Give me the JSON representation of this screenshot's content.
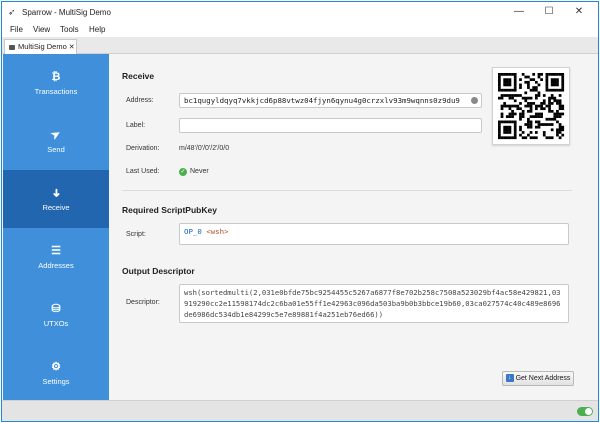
{
  "window": {
    "title": "Sparrow - MultiSig Demo",
    "controls": {
      "minimize": "—",
      "maximize": "☐",
      "close": "✕"
    }
  },
  "menu": [
    "File",
    "View",
    "Tools",
    "Help"
  ],
  "tab": {
    "label": "MultiSig Demo",
    "close": "✕"
  },
  "sidebar": {
    "items": [
      {
        "label": "Transactions",
        "icon": "bitcoin-icon",
        "glyph": "₿"
      },
      {
        "label": "Send",
        "icon": "send-icon",
        "glyph": "➤"
      },
      {
        "label": "Receive",
        "icon": "receive-icon",
        "glyph": "➜",
        "active": true
      },
      {
        "label": "Addresses",
        "icon": "addresses-icon",
        "glyph": "☰"
      },
      {
        "label": "UTXOs",
        "icon": "utxos-icon",
        "glyph": "⛁"
      },
      {
        "label": "Settings",
        "icon": "settings-icon",
        "glyph": "⚙"
      }
    ]
  },
  "receive": {
    "title": "Receive",
    "address_label": "Address:",
    "address": "bc1qugyldqyq7vkkjcd6p88vtwz04fjyn6qynu4g0crzxlv93m9wqnns0z9du9",
    "label_label": "Label:",
    "label_value": "",
    "derivation_label": "Derivation:",
    "derivation": "m/48'/0'/0'/2'/0/0",
    "last_used_label": "Last Used:",
    "last_used": "Never"
  },
  "script_section": {
    "title": "Required ScriptPubKey",
    "label": "Script:",
    "opcode": "OP_0",
    "placeholder": "<wsh>"
  },
  "descriptor_section": {
    "title": "Output Descriptor",
    "label": "Descriptor:",
    "value": "wsh(sortedmulti(2,031e0bfde75bc9254455c5267a6877f8e702b258c7508a523029bf4ac58e429821,03919290cc2e11598174dc2c6ba01e55ff1e42963c096da503ba9b0b3bbce19b60,03ca027574c40c489e8696de6986dc534db1e84299c5e7e89881f4a251eb76ed66))"
  },
  "actions": {
    "next_address": "Get Next Address"
  },
  "colors": {
    "sidebar": "#3f8fdb",
    "sidebar_active": "#2266b0",
    "accent": "#1e8bd9",
    "status_ok": "#4caf50"
  }
}
